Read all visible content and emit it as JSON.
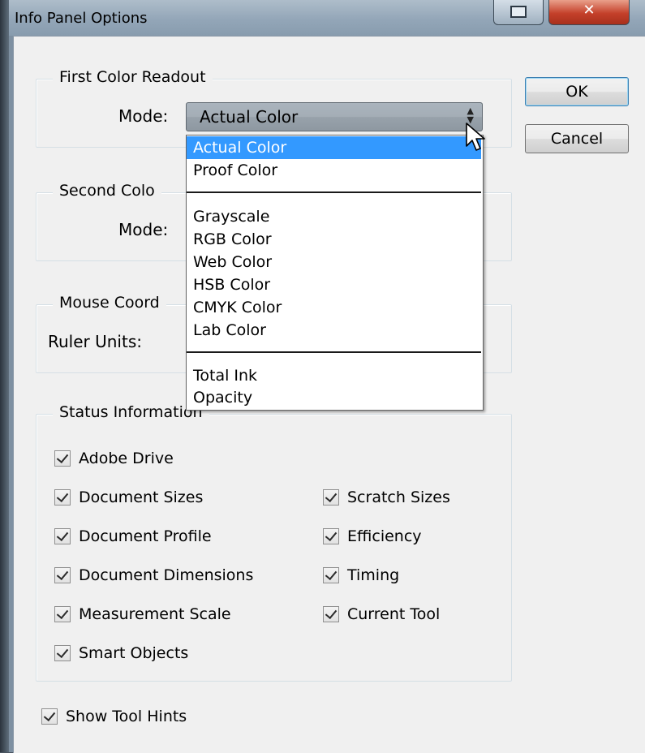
{
  "window": {
    "title": "Info Panel Options",
    "close_glyph": "✕"
  },
  "first_readout": {
    "legend": "First Color Readout",
    "mode_label": "Mode:",
    "mode_value": "Actual Color"
  },
  "second_readout": {
    "legend": "Second Colo",
    "mode_label": "Mode:"
  },
  "mouse_coords": {
    "legend": "Mouse Coord",
    "ruler_label": "Ruler Units:"
  },
  "status": {
    "legend": "Status Information",
    "items": [
      {
        "label": "Adobe Drive",
        "checked": true
      },
      {
        "label": "Document Sizes",
        "checked": true
      },
      {
        "label": "Document Profile",
        "checked": true
      },
      {
        "label": "Document Dimensions",
        "checked": true
      },
      {
        "label": "Measurement Scale",
        "checked": true
      },
      {
        "label": "Smart Objects",
        "checked": true
      },
      {
        "label": "Scratch Sizes",
        "checked": true
      },
      {
        "label": "Efficiency",
        "checked": true
      },
      {
        "label": "Timing",
        "checked": true
      },
      {
        "label": "Current Tool",
        "checked": true
      }
    ]
  },
  "show_tool_hints": {
    "label": "Show Tool Hints",
    "checked": true
  },
  "buttons": {
    "ok": "OK",
    "cancel": "Cancel"
  },
  "mode_menu": {
    "items": [
      {
        "label": "Actual Color",
        "selected": true
      },
      {
        "label": "Proof Color"
      },
      {
        "label": "Grayscale"
      },
      {
        "label": "RGB Color"
      },
      {
        "label": "Web Color"
      },
      {
        "label": "HSB Color"
      },
      {
        "label": "CMYK Color"
      },
      {
        "label": "Lab Color"
      },
      {
        "label": "Total Ink"
      },
      {
        "label": "Opacity"
      }
    ]
  },
  "colors": {
    "selection": "#3399ff",
    "dialog_bg": "#f0f0f0"
  }
}
